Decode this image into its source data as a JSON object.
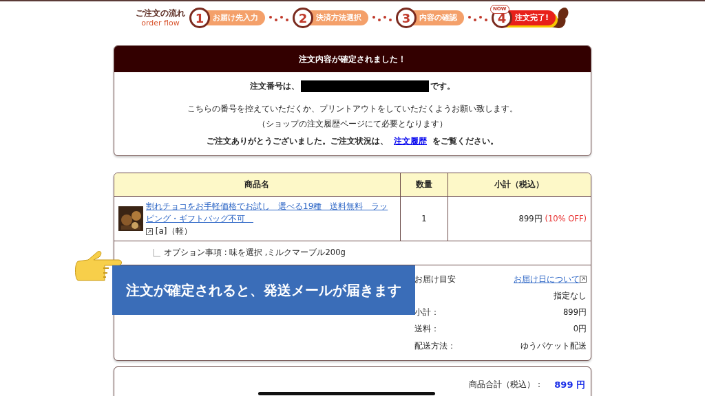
{
  "order_flow": {
    "title": "ご注文の流れ",
    "subtitle": "order flow",
    "steps": [
      {
        "number": "1",
        "label": "お届け先入力",
        "selected": false
      },
      {
        "number": "2",
        "label": "決済方法選択",
        "selected": false
      },
      {
        "number": "3",
        "label": "内容の確認",
        "selected": false
      },
      {
        "number": "4",
        "label": "注文完了!",
        "selected": true,
        "badge": "NOW"
      }
    ]
  },
  "confirmation": {
    "header": "注文内容が確定されました！",
    "order_number_prefix": "注文番号は、",
    "order_number_suffix": "です。",
    "notes": [
      "こちらの番号を控えていただくか、プリントアウトをしていただくようお願い致します。",
      "（ショップの注文履歴ページにて必要となります）"
    ],
    "thanks_before": "ご注文ありがとうございました。ご注文状況は、",
    "history_link": "注文履歴",
    "thanks_after": "をご覧ください。"
  },
  "table": {
    "columns": [
      "商品名",
      "数量",
      "小計（税込）"
    ],
    "rows": [
      {
        "product": "割れチョコをお手軽価格でお試し　選べる19種　送料無料　ラッピング・ギフトバッグ不可　",
        "tags": "[a]（軽）",
        "quantity": "1",
        "subtotal": "899円",
        "discount": "(10% OFF)",
        "option": "オプション事項 : 味を選択 ,ミルクマーブル200g"
      }
    ]
  },
  "delivery": [
    {
      "kind": "link",
      "label": "お届け目安",
      "value": "お届け日について"
    },
    {
      "kind": "text",
      "value": "指定なし"
    },
    {
      "kind": "text",
      "label": "小計：",
      "value": "899円"
    },
    {
      "kind": "text",
      "label": "送料：",
      "value": "0円"
    },
    {
      "kind": "text",
      "label": "配送方法：",
      "value": "ゆうパケット配送"
    }
  ],
  "total": {
    "label": "商品合計（税込）：",
    "value": "899 円"
  },
  "banner": {
    "text": "注文が確定されると、発送メールが届きます"
  }
}
